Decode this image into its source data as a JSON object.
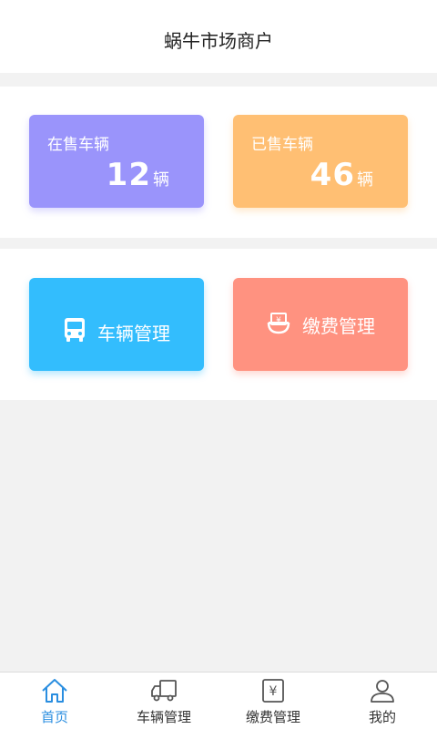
{
  "header": {
    "title": "蜗牛市场商户"
  },
  "stats": {
    "on_sale": {
      "label": "在售车辆",
      "count": "12",
      "unit": "辆"
    },
    "sold": {
      "label": "已售车辆",
      "count": "46",
      "unit": "辆"
    }
  },
  "actions": {
    "vehicle_mgmt": {
      "label": "车辆管理",
      "icon": "bus-icon"
    },
    "fee_mgmt": {
      "label": "缴费管理",
      "icon": "fee-icon"
    }
  },
  "tabbar": {
    "active": "home",
    "active_color": "#2a8ee0",
    "items": [
      {
        "label": "首页",
        "icon": "home-icon"
      },
      {
        "label": "车辆管理",
        "icon": "truck-icon"
      },
      {
        "label": "缴费管理",
        "icon": "yen-icon"
      },
      {
        "label": "我的",
        "icon": "user-icon"
      }
    ]
  }
}
